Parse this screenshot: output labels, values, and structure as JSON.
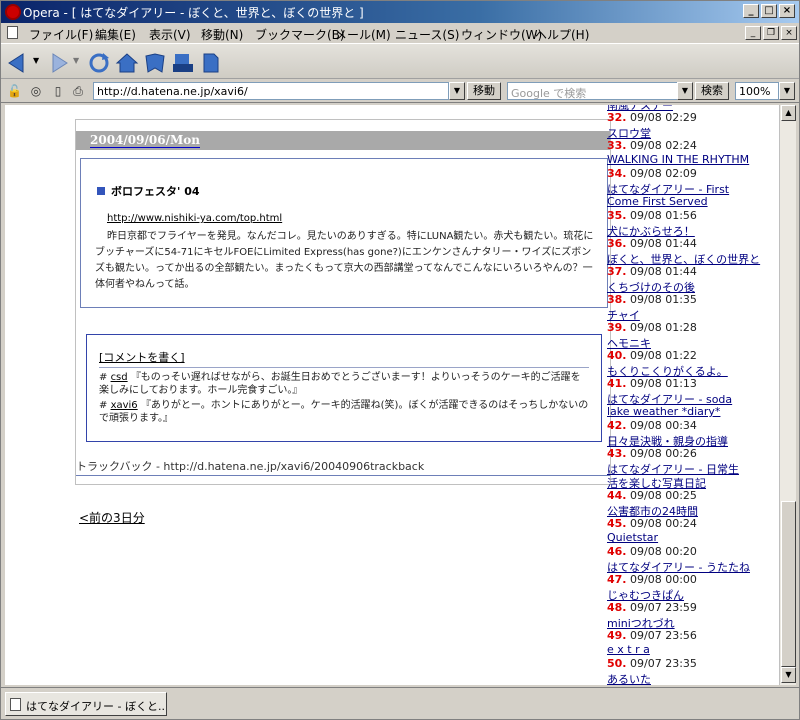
{
  "window": {
    "title": "Opera - [ はてなダイアリー - ぼくと、世界と、ぼくの世界と ]",
    "controls": [
      "_",
      "□",
      "×"
    ]
  },
  "menu": [
    "ファイル(F)",
    "編集(E)",
    "表示(V)",
    "移動(N)",
    "ブックマーク(B)",
    "メール(M)",
    "ニュース(S)",
    "ウィンドウ(W)",
    "ヘルプ(H)"
  ],
  "address": {
    "url": "http://d.hatena.ne.jp/xavi6/",
    "go_label": "移動",
    "search_placeholder": "Google で検索",
    "search_label": "検索",
    "zoom": "100%"
  },
  "entry": {
    "date": "2004/09/06/Mon",
    "section_title": "ボロフェスタ' 04",
    "link": "http://www.nishiki-ya.com/top.html",
    "body": "昨日京都でフライヤーを発見。なんだコレ。見たいのありすぎる。特にLUNA観たい。赤犬も観たい。琉花にブッチャーズに54-71にキセルFOEにLimited Express(has gone?)にエンケンさんナタリー・ワイズにズボンズも観たい。ってか出るの全部観たい。まったくもって京大の西部講堂ってなんでこんなにいろいろやんの？一体何者やねんって話。",
    "comment_header": "[コメントを書く]",
    "comments": [
      {
        "user": "csd",
        "text": "『ものっそい遅ればせながら、お誕生日おめでとうございまーす！よりいっそうのケーキ的ご活躍を楽しみにしております。ホール完食すごい。』"
      },
      {
        "user": "xavi6",
        "text": "『ありがとー。ホントにありがとー。ケーキ的活躍ね(笑)。ぼくが活躍できるのはそっちしかないので頑張ります。』"
      }
    ],
    "trackback": "トラックバック - http://d.hatena.ne.jp/xavi6/20040906trackback"
  },
  "prev_link": "<前の3日分",
  "sidebar": {
    "partial_top": "南風ナステー",
    "items": [
      {
        "num": "32.",
        "time": "09/08 02:29",
        "title": [
          "スロウ堂"
        ]
      },
      {
        "num": "33.",
        "time": "09/08 02:24",
        "title": [
          "WALKING IN THE RHYTHM"
        ]
      },
      {
        "num": "34.",
        "time": "09/08 02:09",
        "title": [
          "はてなダイアリー - First",
          "Come First Served"
        ]
      },
      {
        "num": "35.",
        "time": "09/08 01:56",
        "title": [
          "犬にかぶらせろ！"
        ]
      },
      {
        "num": "36.",
        "time": "09/08 01:44",
        "title": [
          "ぼくと、世界と、ぼくの世界と"
        ]
      },
      {
        "num": "37.",
        "time": "09/08 01:44",
        "title": [
          "くちづけのその後"
        ]
      },
      {
        "num": "38.",
        "time": "09/08 01:35",
        "title": [
          "チャイ"
        ]
      },
      {
        "num": "39.",
        "time": "09/08 01:28",
        "title": [
          "ヘモニキ"
        ]
      },
      {
        "num": "40.",
        "time": "09/08 01:22",
        "title": [
          "もくりこくりがくるよ。"
        ]
      },
      {
        "num": "41.",
        "time": "09/08 01:13",
        "title": [
          "はてなダイアリー - soda",
          "lake weather *diary*"
        ]
      },
      {
        "num": "42.",
        "time": "09/08 00:34",
        "title": [
          "日々是決戦・親身の指導"
        ]
      },
      {
        "num": "43.",
        "time": "09/08 00:26",
        "title": [
          "はてなダイアリー - 日常生",
          "活を楽しむ写真日記"
        ]
      },
      {
        "num": "44.",
        "time": "09/08 00:25",
        "title": [
          "公害都市の24時間"
        ]
      },
      {
        "num": "45.",
        "time": "09/08 00:24",
        "title": [
          "Quietstar"
        ]
      },
      {
        "num": "46.",
        "time": "09/08 00:20",
        "title": [
          "はてなダイアリー - うたたね"
        ]
      },
      {
        "num": "47.",
        "time": "09/08 00:00",
        "title": [
          "じゃむつきぱん"
        ]
      },
      {
        "num": "48.",
        "time": "09/07 23:59",
        "title": [
          "miniつれづれ"
        ]
      },
      {
        "num": "49.",
        "time": "09/07 23:56",
        "title": [
          "e x t r a"
        ]
      },
      {
        "num": "50.",
        "time": "09/07 23:35",
        "title": [
          "あるいた"
        ]
      }
    ]
  },
  "status": {
    "tab_title": "はてなダイアリー - ぼくと..."
  },
  "colors": {
    "title_gradient_start": "#0a246a",
    "rank_number": "#e00000",
    "link": "#000080",
    "date_header_bg": "#a9a9a9"
  }
}
